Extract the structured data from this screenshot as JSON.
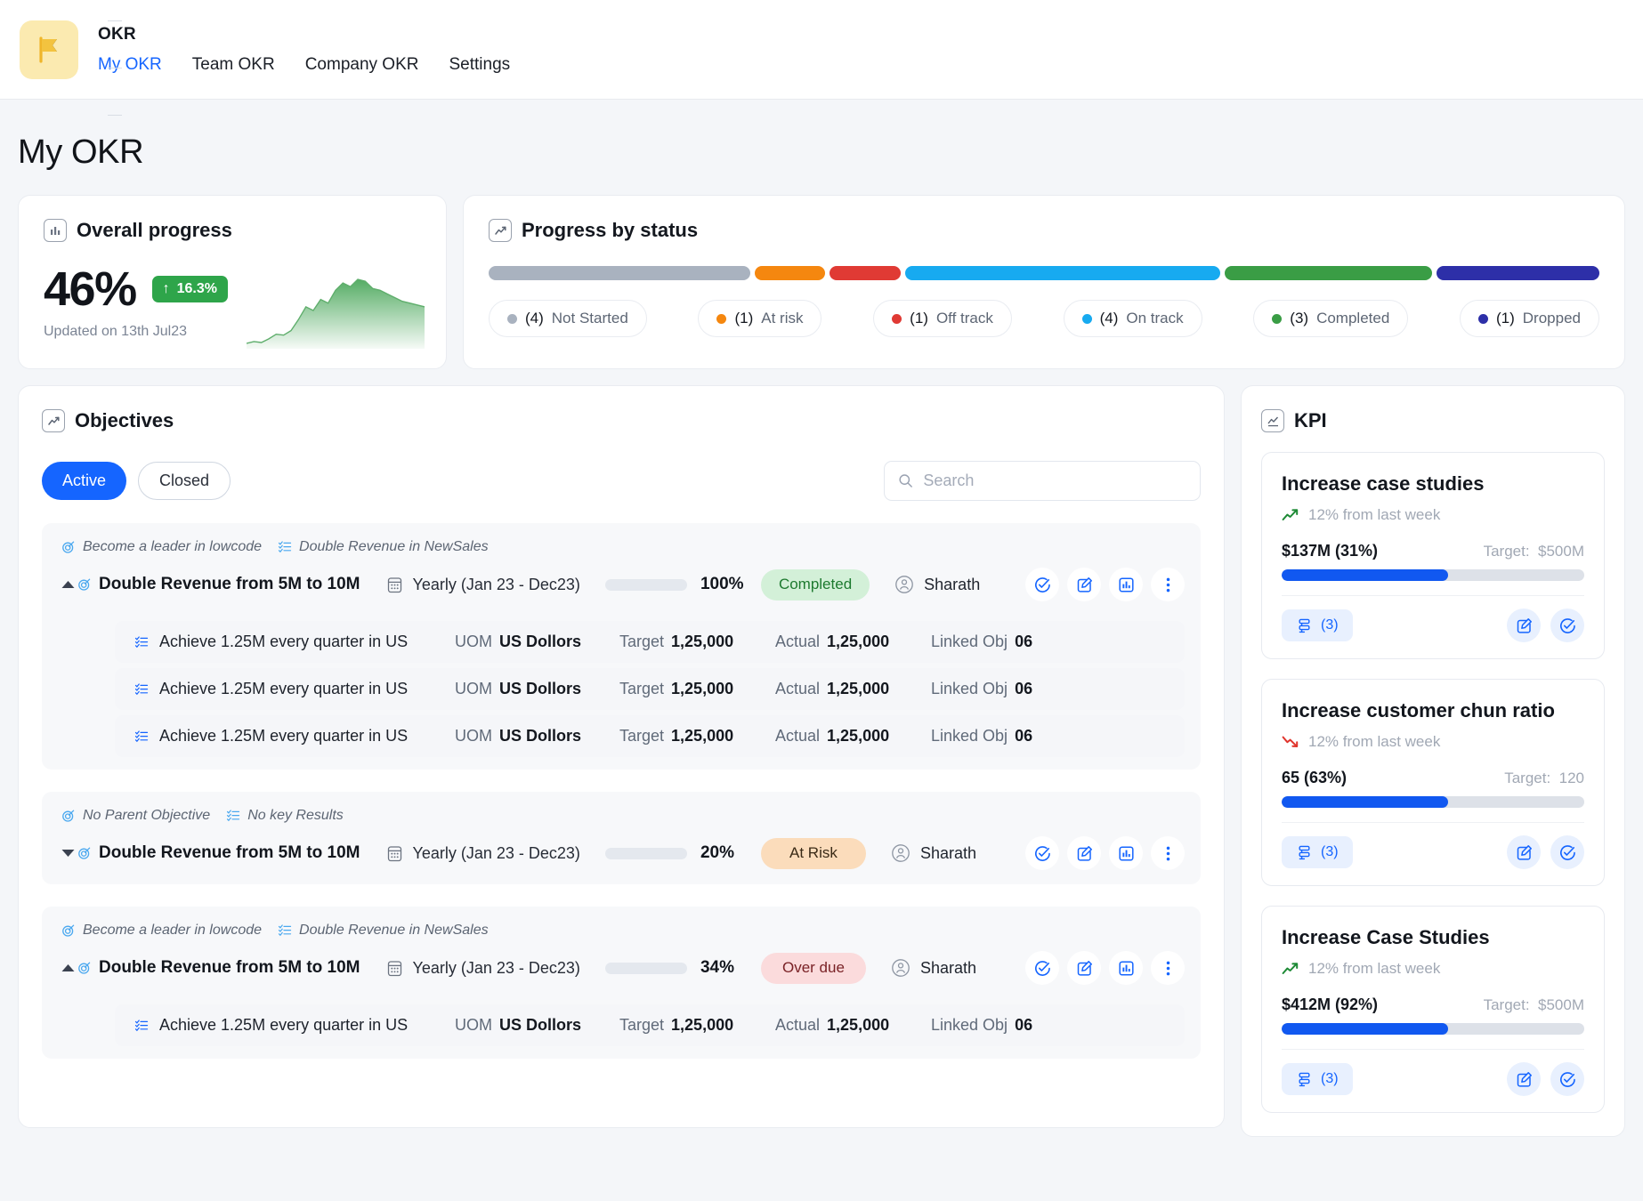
{
  "header": {
    "brand": "OKR",
    "logo_icon": "flag-icon",
    "nav": [
      {
        "label": "My OKR",
        "active": true
      },
      {
        "label": "Team OKR",
        "active": false
      },
      {
        "label": "Company OKR",
        "active": false
      },
      {
        "label": "Settings",
        "active": false
      }
    ]
  },
  "page": {
    "title": "My OKR"
  },
  "overall": {
    "card_title": "Overall progress",
    "icon": "bar-chart-icon",
    "percent": "46%",
    "delta": "16.3%",
    "delta_arrow": "↑",
    "delta_color": "#2ea54a",
    "updated": "Updated on 13th Jul23",
    "sparkline": [
      4,
      6,
      5,
      9,
      14,
      13,
      18,
      30,
      44,
      40,
      52,
      48,
      62,
      70,
      66,
      74,
      72,
      64,
      62,
      58,
      54,
      50,
      48,
      46,
      44
    ]
  },
  "progress_by_status": {
    "card_title": "Progress by status",
    "icon": "trend-icon",
    "segments": [
      {
        "label": "Not Started",
        "count": "(4)",
        "color": "#a9b2bf",
        "weight": 24
      },
      {
        "label": "At risk",
        "count": "(1)",
        "color": "#f5870f",
        "weight": 6.5
      },
      {
        "label": "Off track",
        "count": "(1)",
        "color": "#e03a34",
        "weight": 6.5
      },
      {
        "label": "On track",
        "count": "(4)",
        "color": "#17aaf0",
        "weight": 29
      },
      {
        "label": "Completed",
        "count": "(3)",
        "color": "#3a9d45",
        "weight": 19
      },
      {
        "label": "Dropped",
        "count": "(1)",
        "color": "#2d2fa8",
        "weight": 15
      }
    ]
  },
  "objectives": {
    "card_title": "Objectives",
    "icon": "trend-icon",
    "filters": [
      {
        "label": "Active",
        "active": true
      },
      {
        "label": "Closed",
        "active": false
      }
    ],
    "search": {
      "placeholder": "Search",
      "value": "",
      "icon": "search-icon"
    },
    "kr_labels": {
      "uom": "UOM",
      "target": "Target",
      "actual": "Actual",
      "linked": "Linked Obj"
    },
    "groups": [
      {
        "parent": "Become a leader in lowcode",
        "key_result_tag": "Double Revenue in NewSales",
        "expanded": true,
        "caret": "up",
        "name": "Double Revenue from 5M to 10M",
        "cycle": "Yearly (Jan 23 - Dec23)",
        "progress": "100%",
        "progress_value": 100,
        "status": "Completed",
        "status_bg": "#d3f0d8",
        "status_fg": "#1d7a2f",
        "owner": "Sharath",
        "key_results": [
          {
            "name": "Achieve 1.25M every quarter in US",
            "uom": "US Dollors",
            "target": "1,25,000",
            "actual": "1,25,000",
            "linked": "06"
          },
          {
            "name": "Achieve 1.25M every quarter in US",
            "uom": "US Dollors",
            "target": "1,25,000",
            "actual": "1,25,000",
            "linked": "06"
          },
          {
            "name": "Achieve 1.25M every quarter in US",
            "uom": "US Dollors",
            "target": "1,25,000",
            "actual": "1,25,000",
            "linked": "06"
          }
        ]
      },
      {
        "parent": "No Parent Objective",
        "key_result_tag": "No key Results",
        "expanded": false,
        "caret": "down",
        "name": "Double Revenue from 5M to 10M",
        "cycle": "Yearly (Jan 23 - Dec23)",
        "progress": "20%",
        "progress_value": 20,
        "status": "At Risk",
        "status_bg": "#fbdcbb",
        "status_fg": "#3a2a16",
        "owner": "Sharath",
        "key_results": []
      },
      {
        "parent": "Become a leader in lowcode",
        "key_result_tag": "Double Revenue in NewSales",
        "expanded": true,
        "caret": "up",
        "name": "Double Revenue from 5M to 10M",
        "cycle": "Yearly (Jan 23 - Dec23)",
        "progress": "34%",
        "progress_value": 34,
        "status": "Over due",
        "status_bg": "#fbdbdc",
        "status_fg": "#7a2226",
        "owner": "Sharath",
        "key_results": [
          {
            "name": "Achieve 1.25M every quarter in US",
            "uom": "US Dollors",
            "target": "1,25,000",
            "actual": "1,25,000",
            "linked": "06"
          }
        ]
      }
    ]
  },
  "kpi": {
    "card_title": "KPI",
    "icon": "kpi-chart-icon",
    "cards": [
      {
        "title": "Increase case studies",
        "trend_text": "12% from last week",
        "trend_dir": "up",
        "trend_color": "#1d8a35",
        "current": "$137M  (31%)",
        "target_label": "Target:",
        "target": "$500M",
        "fill": 55,
        "link_count": "(3)"
      },
      {
        "title": "Increase customer chun ratio",
        "trend_text": "12% from last week",
        "trend_dir": "down",
        "trend_color": "#e0342c",
        "current": "65  (63%)",
        "target_label": "Target:",
        "target": "120",
        "fill": 55,
        "link_count": "(3)"
      },
      {
        "title": "Increase Case Studies",
        "trend_text": "12% from last week",
        "trend_dir": "up",
        "trend_color": "#1d8a35",
        "current": "$412M (92%)",
        "target_label": "Target:",
        "target": "$500M",
        "fill": 55,
        "link_count": "(3)"
      }
    ]
  }
}
